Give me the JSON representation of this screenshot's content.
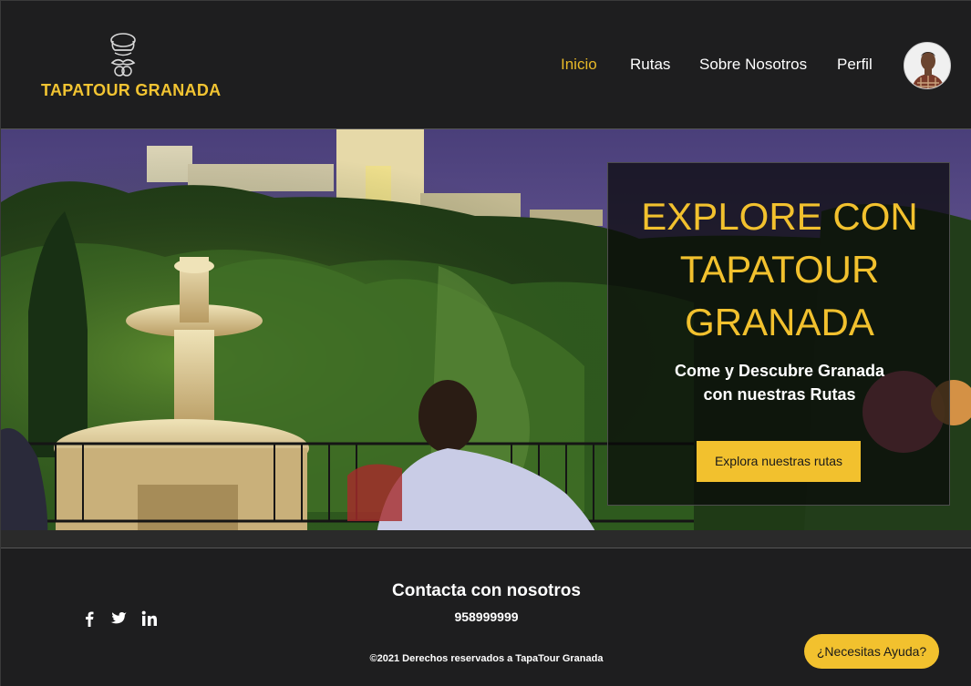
{
  "brand": {
    "logo_text": "TAPATOUR GRANADA",
    "accent": "#f2c12e"
  },
  "nav": {
    "items": [
      {
        "label": "Inicio",
        "active": true
      },
      {
        "label": "Rutas",
        "active": false
      },
      {
        "label": "Sobre Nosotros",
        "active": false
      },
      {
        "label": "Perfil",
        "active": false
      }
    ],
    "avatar_icon": "user-avatar"
  },
  "hero": {
    "title_lines": [
      "EXPLORE CON",
      "TAPATOUR",
      "GRANADA"
    ],
    "subtitle_lines": [
      "Come y Descubre Granada",
      "con nuestras Rutas"
    ],
    "cta_label": "Explora nuestras rutas"
  },
  "footer": {
    "social_icons": [
      "facebook-icon",
      "twitter-icon",
      "linkedin-icon"
    ],
    "contact_title": "Contacta con nosotros",
    "phone": "958999999",
    "copyright": "©2021 Derechos reservados a TapaTour Granada",
    "help_label": "¿Necesitas Ayuda?"
  }
}
